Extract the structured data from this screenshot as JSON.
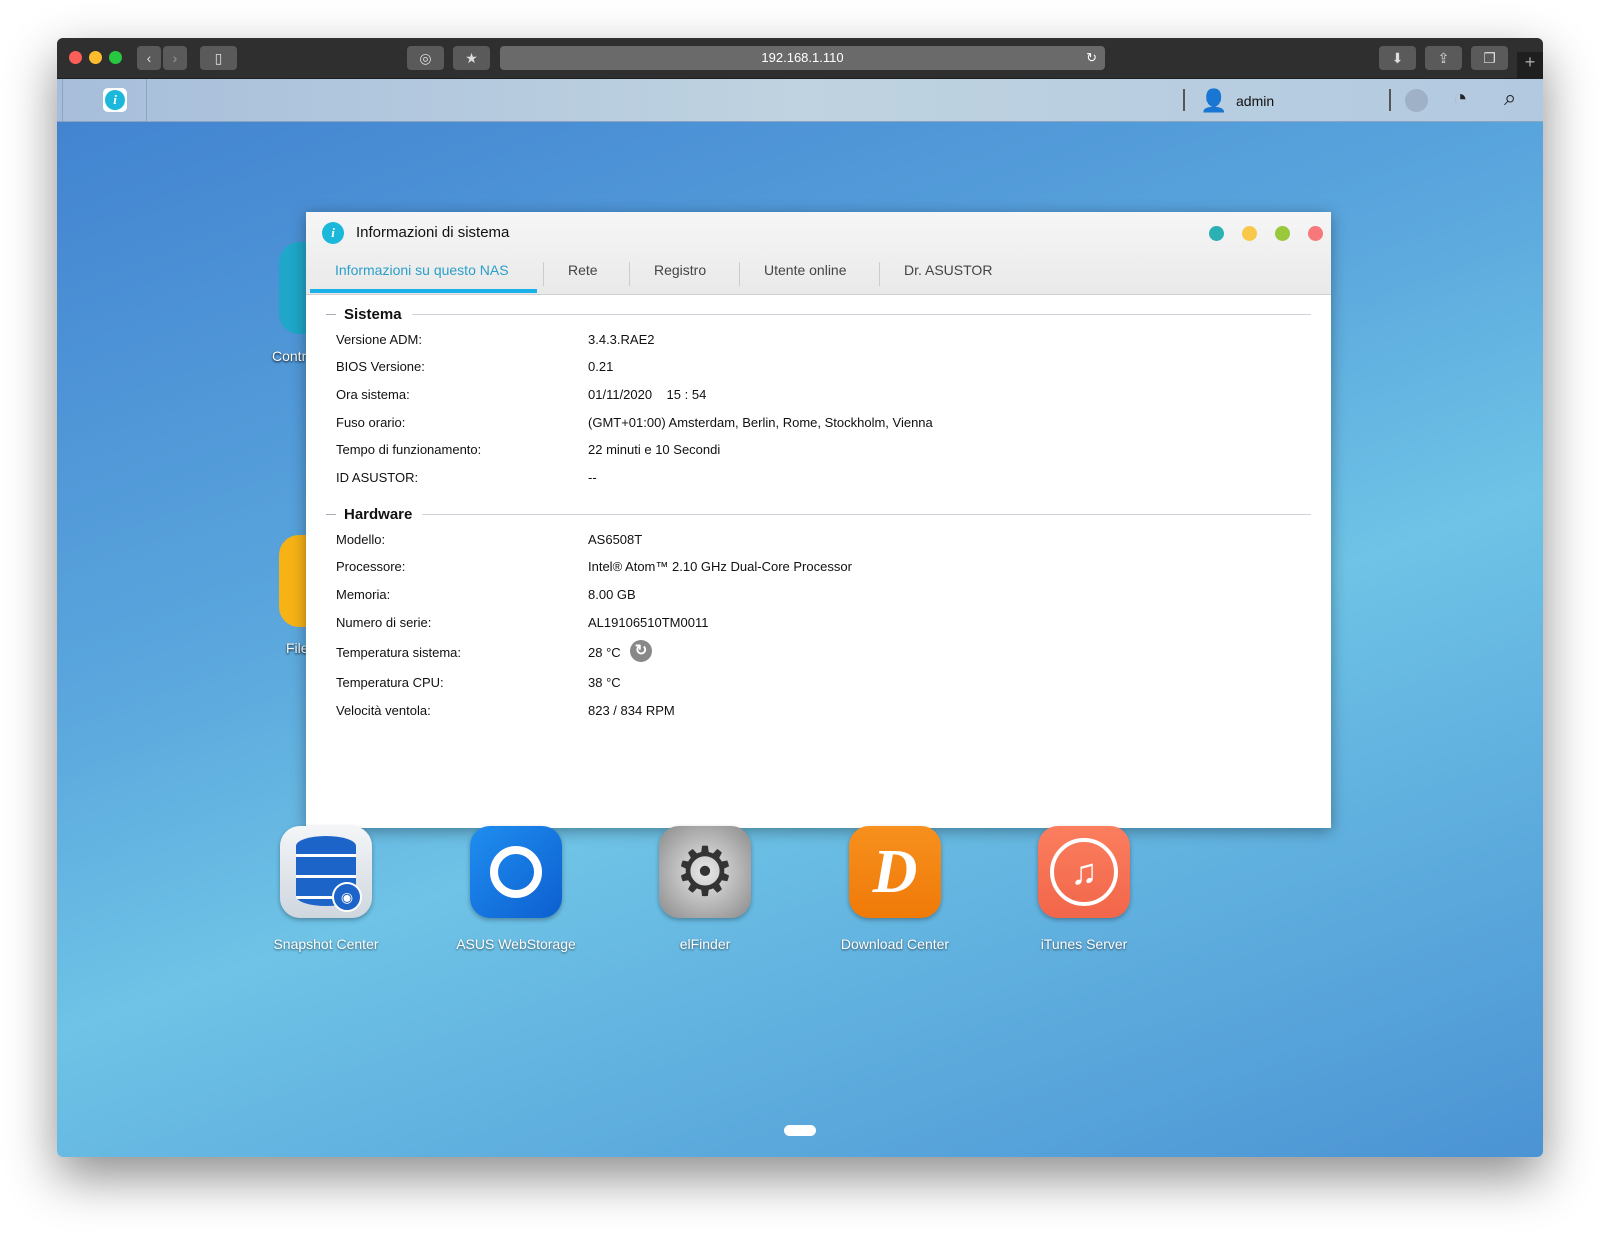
{
  "browser": {
    "url": "192.168.1.110"
  },
  "adm": {
    "user": "admin"
  },
  "dialog": {
    "title": "Informazioni di sistema",
    "tabs": [
      "Informazioni su questo NAS",
      "Rete",
      "Registro",
      "Utente online",
      "Dr. ASUSTOR"
    ],
    "sections": {
      "system": {
        "title": "Sistema",
        "rows": [
          {
            "label": "Versione ADM:",
            "value": "3.4.3.RAE2"
          },
          {
            "label": "BIOS Versione:",
            "value": "0.21"
          },
          {
            "label": "Ora sistema:",
            "value": "01/11/2020    15 : 54"
          },
          {
            "label": "Fuso orario:",
            "value": "(GMT+01:00) Amsterdam, Berlin, Rome, Stockholm, Vienna"
          },
          {
            "label": "Tempo di funzionamento:",
            "value": "22 minuti e 10 Secondi"
          },
          {
            "label": "ID ASUSTOR:",
            "value": "--"
          }
        ]
      },
      "hardware": {
        "title": "Hardware",
        "rows": [
          {
            "label": "Modello:",
            "value": "AS6508T"
          },
          {
            "label": "Processore:",
            "value": "Intel® Atom™ 2.10 GHz Dual-Core Processor"
          },
          {
            "label": "Memoria:",
            "value": "8.00 GB"
          },
          {
            "label": "Numero di serie:",
            "value": "AL19106510TM0011"
          },
          {
            "label": "Temperatura sistema:",
            "value": "28 °C"
          },
          {
            "label": "Temperatura CPU:",
            "value": "38 °C"
          },
          {
            "label": "Velocità ventola:",
            "value": "823 / 834 RPM"
          }
        ]
      }
    }
  },
  "desktop": {
    "partial_apps": [
      "Contr",
      "File"
    ],
    "apps": [
      "Snapshot Center",
      "ASUS WebStorage",
      "elFinder",
      "Download Center",
      "iTunes Server"
    ]
  }
}
